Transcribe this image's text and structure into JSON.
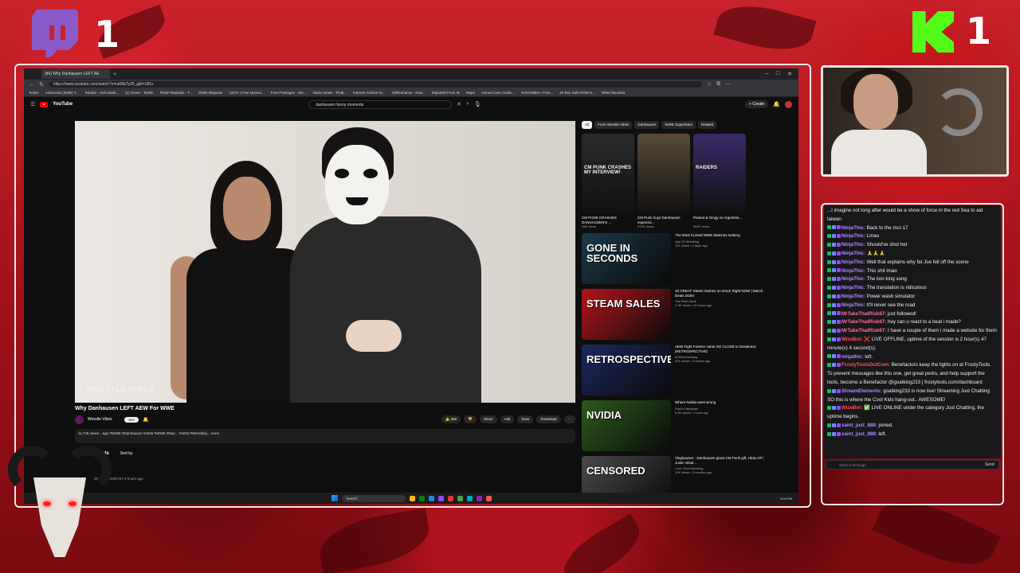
{
  "overlay": {
    "twitch_count": "1",
    "kick_count": "1"
  },
  "browser": {
    "tab_title": "(86) Why Danhausen LEFT AE",
    "url": "https://www.youtube.com/watch?v=ra06b7y2fl_g&t=181s",
    "bookmarks": [
      "Twitch",
      "Anaconda (2025) Y...",
      "Stream - Kick Dash...",
      "(1) Home - Twitch",
      "FitGirl Repacks - T...",
      "DODI Repacks",
      "1337x | Free Movies...",
      "Free Packages - Ste...",
      "Game Deals - Findi...",
      "Internet Archive Di...",
      "CDRomance - Dow...",
      "Imported From IE",
      "Maps",
      "Animal Care Cente...",
      "IXXGAMES • Free...",
      "Z3 Box Safe ROM S...",
      "Other favorites"
    ]
  },
  "youtube": {
    "logo_text": "YouTube",
    "search_query": "danhausen funny moments",
    "create_label": "+ Create",
    "video_watermark": "WRESTLE VIBES",
    "video_title": "Why Danhausen LEFT AEW For WWE",
    "channel_name": "Wrestle Vibes",
    "subscribe_label": "Join",
    "actions": [
      "👍 259",
      "👎",
      "Share",
      "Ask",
      "Save",
      "Download",
      "⋯"
    ],
    "description": "11,746 views  ...ago  #WWE #Danhausen #AEW  #WWE #Dan... #AEW #Wrestling ...more",
    "comments_count": "183 Comments",
    "sort_label": "Sort by",
    "comment_user": "@ATTEGANDY07  2 hours ago",
    "chips": [
      "All",
      "From Wrestle Vibes",
      "Danhausen",
      "WWE Superstars",
      "Related"
    ],
    "shorts": [
      {
        "caption": "CM PUNK CRASHES MY INTERVIEW!",
        "title": "CM PUNK CRASHES DANHAUSEN'S ...",
        "views": "48K views"
      },
      {
        "caption": "",
        "title": "CM Punk buys Danhausen expensiv...",
        "views": "370K views"
      },
      {
        "caption": "RAIDERS",
        "title": "Peanut & Gingy vs Argentina ...",
        "views": "580K views"
      }
    ],
    "recommended": [
      {
        "thumb_text": "GONE IN SECONDS",
        "thumb_color": "#1b3a4a",
        "title": "The Most Cursed WWE Matches Iceberg",
        "channel": "Age Of Wrestling",
        "views": "11K views • 2 days ago"
      },
      {
        "thumb_text": "STEAM SALES",
        "thumb_color": "#b3141a",
        "title": "15 GREAT Steam Games on SALE Right NOW | March Deals 2026!",
        "channel": "The Pixel Vault",
        "views": "3.3K views • 10 hours ago"
      },
      {
        "thumb_text": "RETROSPECTIVE",
        "thumb_color": "#1c2760",
        "title": "AEW Fight Forever came SO CLOSE to Greatness (RETROSPECTIVE)",
        "channel": "61RetroGaming",
        "views": "91K views • 3 weeks ago"
      },
      {
        "thumb_text": "NVIDIA",
        "thumb_color": "#2c5a1b",
        "title": "Where Nvidia went wrong",
        "channel": "Paul's Hardware",
        "views": "8.3K views • 1 hour ago"
      },
      {
        "thumb_text": "CENSORED",
        "thumb_color": "#4a4a4a",
        "title": "Visghausen - Danhausen gives CM Punk gift, Hirao AF*, Justin Shutr...",
        "channel": "Love That Wrestling",
        "views": "10K views • 3 months ago"
      }
    ]
  },
  "taskbar": {
    "search_label": "Search",
    "tray_time": "3:04 PM"
  },
  "chat": {
    "messages": [
      {
        "user": "",
        "text": "...I imagine not long after would be a show of force in the red Sea to aid taiwan",
        "color": "#efeff1"
      },
      {
        "user": "NinjaThic",
        "text": "Back to the mcr-17",
        "color": "#b08cff"
      },
      {
        "user": "NinjaThic",
        "text": "Lmao",
        "color": "#b08cff"
      },
      {
        "user": "NinjaThic",
        "text": "Should've shot her",
        "color": "#b08cff"
      },
      {
        "user": "NinjaThic",
        "text": "🙏🙏🙏",
        "color": "#b08cff"
      },
      {
        "user": "NinjaThic",
        "text": "Well that explains why fat Joe fell off the scene",
        "color": "#b08cff"
      },
      {
        "user": "NinjaThic",
        "text": "This shit lmao",
        "color": "#b08cff"
      },
      {
        "user": "NinjaThic",
        "text": "The lion king song",
        "color": "#b08cff"
      },
      {
        "user": "NinjaThic",
        "text": "The translation is ridiculous",
        "color": "#b08cff"
      },
      {
        "user": "NinjaThic",
        "text": "Power wash simulator",
        "color": "#b08cff"
      },
      {
        "user": "NinjaThic",
        "text": "It'll never see the road",
        "color": "#b08cff"
      },
      {
        "user": "MrTakeThatRisk67",
        "text": "just followed!",
        "color": "#ff6fa0"
      },
      {
        "user": "MrTakeThatRisk67",
        "text": "hey can u react to a beat i made?",
        "color": "#ff6fa0"
      },
      {
        "user": "MrTakeThatRisk67",
        "text": "I have a couple of them i made a website for them",
        "color": "#ff6fa0"
      },
      {
        "user": "WizeBot",
        "text": "❌ LIVE OFFLINE, uptime of the session is 2 hour(s) 47 minute(s) 4 second(s).",
        "color": "#ff4f4f"
      },
      {
        "user": "ninjathic",
        "text": "left.",
        "color": "#b08cff"
      },
      {
        "user": "FrostyToolsDotCom",
        "text": "Benefactors keep the lights on at FrostyTools. To prevent messages like this one, get great perks, and help support the tools, become a Benefactor @goatking233 | frostytools.com/dashboard",
        "color": "#ff4f4f"
      },
      {
        "user": "StreamElements",
        "text": "goatking233 is now live! Streaming Just Chatting: SO this is where the Cool Kids hang-out.. AWESOME!",
        "color": "#b08cff"
      },
      {
        "user": "WizeBot",
        "text": "✅ LIVE ONLINE under the category Just Chatting, the uptime begins.",
        "color": "#ff4f4f"
      },
      {
        "user": "saint_just_888",
        "text": "joined.",
        "color": "#b08cff"
      },
      {
        "user": "saint_just_888",
        "text": "left.",
        "color": "#b08cff"
      }
    ],
    "input_placeholder": "Send a message",
    "send_label": "Send"
  }
}
